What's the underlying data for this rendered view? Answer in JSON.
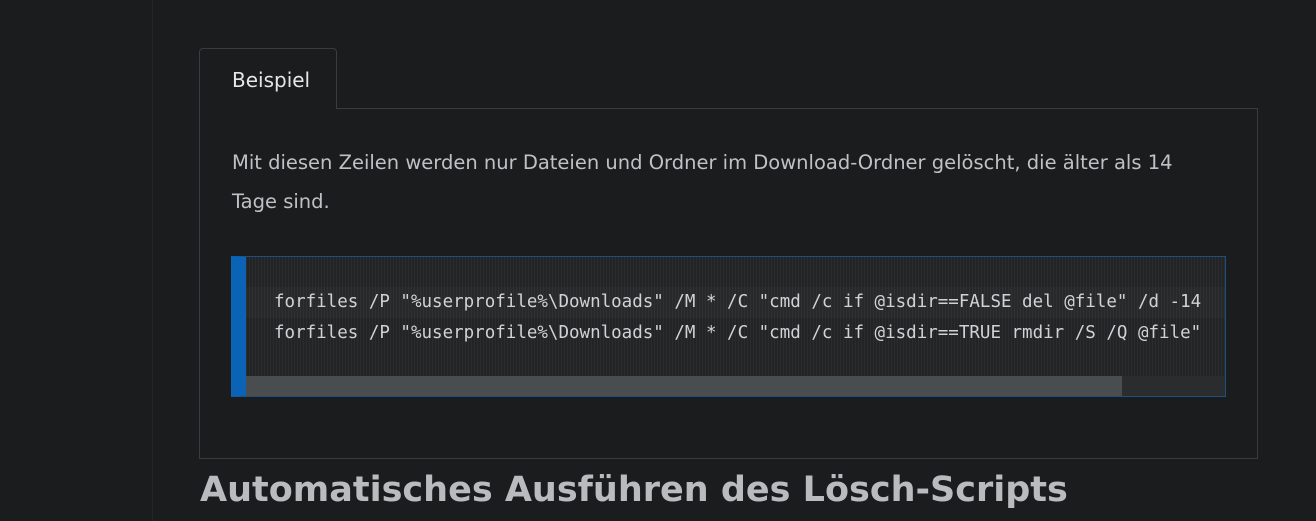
{
  "tabs": [
    {
      "label": "Beispiel",
      "active": true
    }
  ],
  "example": {
    "description": "Mit diesen Zeilen werden nur Dateien und Ordner im Download-Ordner gelöscht, die älter als 14 Tage sind.",
    "code_lines": [
      "forfiles /P \"%userprofile%\\Downloads\" /M * /C \"cmd /c if @isdir==FALSE del @file\" /d -14",
      "forfiles /P \"%userprofile%\\Downloads\" /M * /C \"cmd /c if @isdir==TRUE rmdir /S /Q @file\""
    ]
  },
  "section": {
    "heading": "Automatisches Ausführen des Lösch-Scripts"
  },
  "colors": {
    "background": "#1b1c1d",
    "accent_bar": "#0b63b6",
    "text": "#bfc2c4"
  }
}
